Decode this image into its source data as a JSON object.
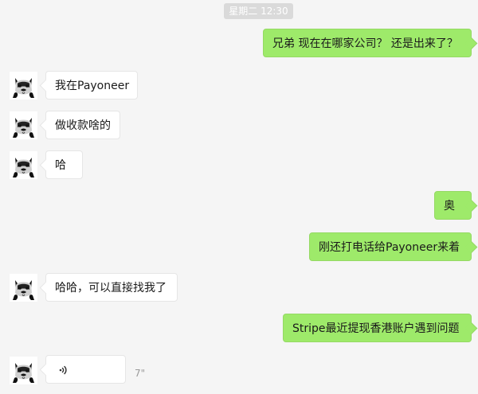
{
  "timestamp": "星期二 12:30",
  "messages": [
    {
      "side": "right",
      "text": "兄弟 现在在哪家公司？ 还是出来了？"
    },
    {
      "side": "left",
      "text": "我在Payoneer"
    },
    {
      "side": "left",
      "text": "做收款啥的"
    },
    {
      "side": "left",
      "text": "哈"
    },
    {
      "side": "right",
      "text": "奥"
    },
    {
      "side": "right",
      "text": "刚还打电话给Payoneer来着"
    },
    {
      "side": "left",
      "text": "哈哈，可以直接找我了"
    },
    {
      "side": "right",
      "text": "Stripe最近提现香港账户遇到问题"
    },
    {
      "side": "left",
      "type": "voice",
      "duration": "7\""
    }
  ],
  "colors": {
    "background": "#f5f5f5",
    "sent_bubble": "#9eea6a",
    "received_bubble": "#ffffff",
    "timestamp_badge": "#dadada"
  },
  "icons": {
    "avatar": "dog-avatar-icon",
    "voice": "voice-wave-icon"
  }
}
